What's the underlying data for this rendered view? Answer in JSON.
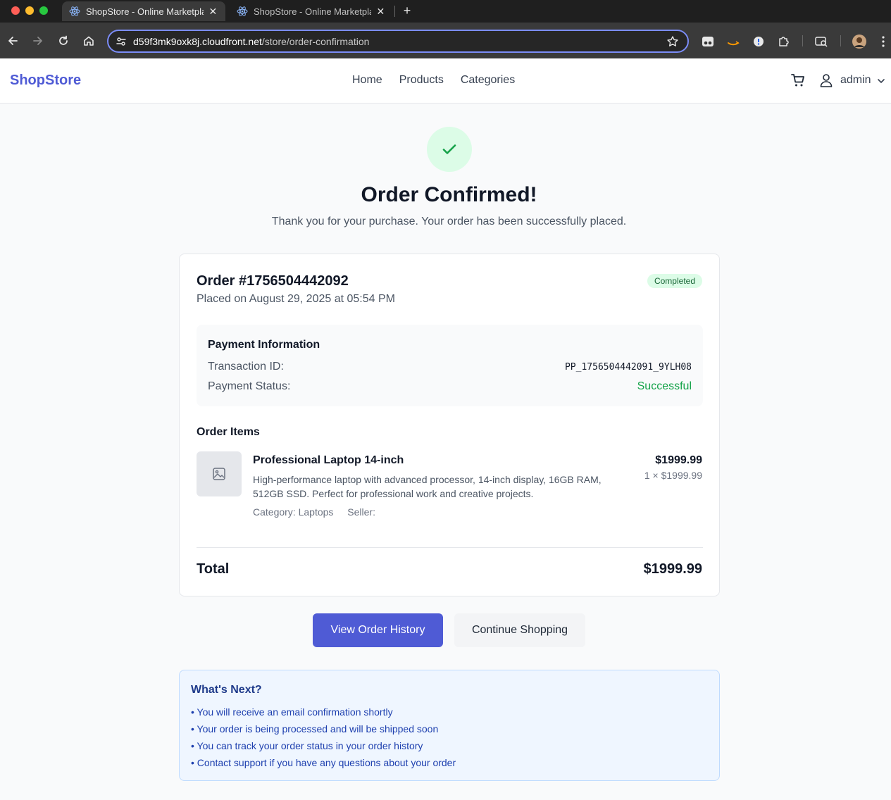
{
  "browser": {
    "tabs": [
      {
        "title": "ShopStore - Online Marketplace",
        "active": true
      },
      {
        "title": "ShopStore - Online Marketplace",
        "active": false
      }
    ],
    "url_host": "d59f3mk9oxk8j.cloudfront.net",
    "url_path": "/store/order-confirmation"
  },
  "header": {
    "logo": "ShopStore",
    "nav": [
      "Home",
      "Products",
      "Categories"
    ],
    "user": "admin"
  },
  "hero": {
    "title": "Order Confirmed!",
    "subtitle": "Thank you for your purchase. Your order has been successfully placed."
  },
  "order": {
    "number": "Order #1756504442092",
    "placed": "Placed on August 29, 2025 at 05:54 PM",
    "status": "Completed",
    "payment": {
      "title": "Payment Information",
      "transaction_label": "Transaction ID:",
      "transaction_id": "PP_1756504442091_9YLH08",
      "status_label": "Payment Status:",
      "status_value": "Successful"
    },
    "items_title": "Order Items",
    "items": [
      {
        "name": "Professional Laptop 14-inch",
        "description": "High-performance laptop with advanced processor, 14-inch display, 16GB RAM, 512GB SSD. Perfect for professional work and creative projects.",
        "category": "Category: Laptops",
        "seller": "Seller:",
        "price": "$1999.99",
        "qty_line": "1 × $1999.99"
      }
    ],
    "total_label": "Total",
    "total_value": "$1999.99"
  },
  "actions": {
    "history": "View Order History",
    "continue": "Continue Shopping"
  },
  "next": {
    "title": "What's Next?",
    "items": [
      "You will receive an email confirmation shortly",
      "Your order is being processed and will be shipped soon",
      "You can track your order status in your order history",
      "Contact support if you have any questions about your order"
    ]
  },
  "colors": {
    "accent": "#4f5bd5",
    "success": "#16a34a",
    "badge_bg": "#dcfce7"
  }
}
